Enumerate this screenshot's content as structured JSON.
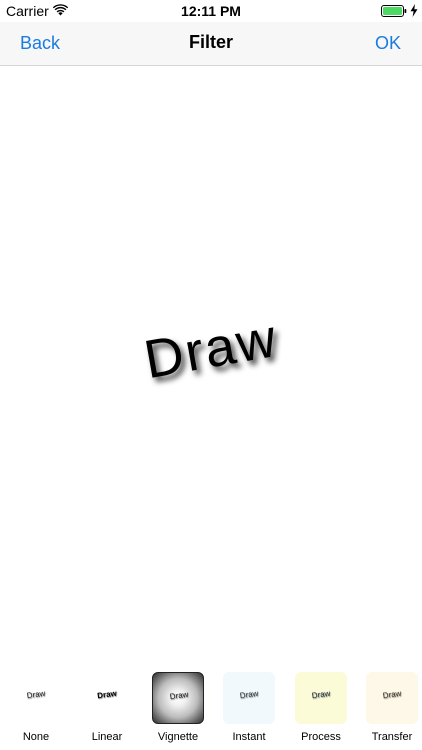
{
  "status_bar": {
    "carrier": "Carrier",
    "time": "12:11 PM",
    "wifi_icon": "wifi-icon",
    "battery_icon": "battery-icon",
    "battery_color": "#4cd964",
    "charging_icon": "charging-bolt-icon"
  },
  "nav": {
    "back_label": "Back",
    "title": "Filter",
    "ok_label": "OK",
    "accent_color": "#1a7ce0"
  },
  "canvas": {
    "text": "Draw"
  },
  "filters": [
    {
      "label": "None",
      "thumb_text": "Draw",
      "thumb_bg": "#ffffff"
    },
    {
      "label": "Linear",
      "thumb_text": "Draw",
      "thumb_bg": "#ffffff"
    },
    {
      "label": "Vignette",
      "thumb_text": "Draw",
      "thumb_bg": "#8a8a8a"
    },
    {
      "label": "Instant",
      "thumb_text": "Draw",
      "thumb_bg": "#f2f9fd"
    },
    {
      "label": "Process",
      "thumb_text": "Draw",
      "thumb_bg": "#fcfbd8"
    },
    {
      "label": "Transfer",
      "thumb_text": "Draw",
      "thumb_bg": "#fdf8e7"
    }
  ]
}
